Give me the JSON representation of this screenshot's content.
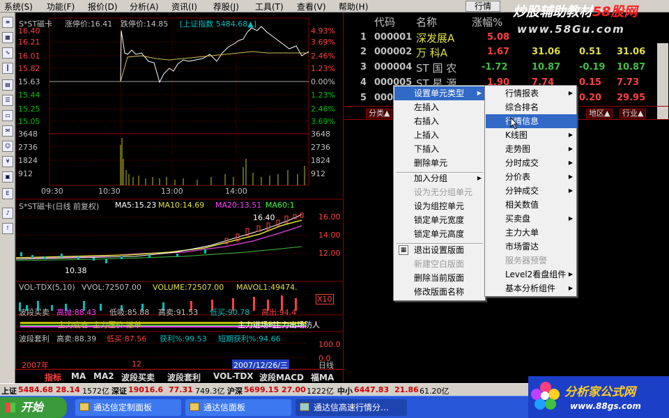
{
  "menubar": {
    "items": [
      "系统(S)",
      "功能(F)",
      "报价(D)",
      "分析(A)",
      "资讯(I)",
      "荐股(J)",
      "工具(T)",
      "查看(V)",
      "帮助(H)"
    ],
    "hq_button": "行情"
  },
  "watermark": {
    "line1_a": "炒股辅助教材",
    "line1_b": "58股网",
    "line2": "www.58Gu.com"
  },
  "chart": {
    "stock_title": "S*ST磁卡",
    "limit_up_label": "涨停价:16.41",
    "limit_down_label": "跌停价:14.85",
    "index_label": "[上证指数 5484.68▲]",
    "price_left": [
      "16.40",
      "16.21",
      "16.01",
      "15.82",
      "15.63",
      "15.44",
      "15.25",
      "15.05",
      "3648",
      "2736",
      "1824",
      "912"
    ],
    "pct_right": [
      "4.93%",
      "3.69%",
      "2.46%",
      "1.23%",
      "0.00%",
      "1.23%",
      "2.46%",
      "3.69%",
      "3648",
      "2736",
      "1824",
      "912"
    ],
    "times": [
      "09:30",
      "10:30",
      "13:00",
      "14:00"
    ],
    "kline_title": "S*ST磁卡(日线 前复权)",
    "ma5": "MA5:15.23",
    "ma10": "MA10:14.69",
    "ma20": "MA20:13.51",
    "ma60": "MA60:1",
    "kline_y": [
      "16.00",
      "14.00",
      "12.00"
    ],
    "kline_high": "16.40",
    "kline_low": "10.38",
    "vol_label": "VOL-TDX(5,10)",
    "vol_value": "VVOL:72507.00",
    "volume": "VOLUME:72507.00",
    "mavol": "MAVOL1:49474.",
    "vol_right": "X10",
    "bd_label": "波段买卖",
    "bd_high": "高抛:88.43",
    "bd_low": "低吸:85.88",
    "bd_sell": "高卖:91.53",
    "bd_buy": "低买:90.78",
    "bd_hint": "高出:94.4",
    "bd_note1": "主力底仓",
    "bd_note2": "主力压价-撤单",
    "bd_note3": "主力进场时",
    "bd_note4": "主力出场防人",
    "tl_label": "波段套利",
    "tl_high": "高卖:88.39",
    "tl_low": "低买:87.56",
    "tl_profit": "获利%:99.53",
    "tl_short": "短期获利%:94.66",
    "tl_y": [
      "100.0",
      "0.0"
    ],
    "date_year": "2007年",
    "date_month": "12",
    "date_current": "2007/12/26/三",
    "period": "日线"
  },
  "bottom_tabs": [
    "指标",
    "MA",
    "MA2",
    "波段买卖",
    "波段套利",
    "VOL-TDX",
    "波段MACD",
    "福MA"
  ],
  "right": {
    "headers": [
      "代码",
      "名称",
      "涨幅%"
    ],
    "rows": [
      {
        "no": "1",
        "code": "000001",
        "name": "深发展A",
        "chg": "5.08",
        "c1": "",
        "c2": "",
        "c3": ""
      },
      {
        "no": "2",
        "code": "000002",
        "name": "万 科A",
        "chg": "1.67",
        "c1": "31.06",
        "c2": "0.51",
        "c3": "31.06"
      },
      {
        "no": "3",
        "code": "000004",
        "name": "ST 国 农",
        "chg": "-1.72",
        "c1": "10.87",
        "c2": "-0.19",
        "c3": "10.87"
      },
      {
        "no": "4",
        "code": "000005",
        "name": "ST 星 源",
        "chg": "1.90",
        "c1": "7.74",
        "c2": "0.15",
        "c3": "7.73"
      },
      {
        "no": "5",
        "code": "000006",
        "name": "",
        "chg": "",
        "c1": "",
        "c2": "0.20",
        "c3": "29.95"
      }
    ],
    "tabs": [
      "分类▲",
      "地区▲",
      "行业▲"
    ]
  },
  "menu1": {
    "items": [
      "设置单元类型",
      "左插入",
      "右插入",
      "上插入",
      "下插入",
      "删除单元",
      "加入分组",
      "设为无分组单元",
      "设为组控单元",
      "锁定单元宽度",
      "锁定单元高度",
      "退出设置版面",
      "新建空白版面",
      "删除当前版面",
      "修改版面名称"
    ]
  },
  "menu2": {
    "items": [
      "行情报表",
      "综合排名",
      "行情信息",
      "K线图",
      "走势图",
      "分时成交",
      "分价表",
      "分钟成交",
      "相关数值",
      "买卖盘",
      "主力大单",
      "市场雷达",
      "服务器预警",
      "Level2看盘组件",
      "基本分析组件"
    ]
  },
  "statusbar": {
    "sh_label": "上证",
    "sh_value": "5484.68",
    "sh_chg": "28.14",
    "sh_vol": "1572亿",
    "sz_label": "深证",
    "sz_value": "19016.6",
    "sz_chg": "77.31",
    "sz_vol": "749.3亿",
    "hs_label": "沪深",
    "hs_value": "5699.15",
    "hs_chg": "27.00",
    "hs_vol": "1222亿",
    "zx_label": "中小",
    "zx_value": "6447.83",
    "zx_chg": "21.86",
    "zx_vol": "61.20亿"
  },
  "taskbar": {
    "start": "开始",
    "tasks": [
      "通达信定制面板",
      "通达信面板",
      "通达信高速行情分…"
    ]
  },
  "ad": {
    "title": "分析家公式网",
    "url": "www.88gs.com"
  }
}
